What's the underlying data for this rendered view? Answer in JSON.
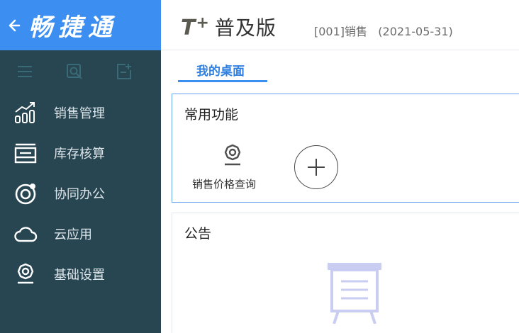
{
  "brand": {
    "title": "畅捷通",
    "back_icon": "arrow-left-icon"
  },
  "sidebar": {
    "toolbar": [
      {
        "icon": "menu-icon"
      },
      {
        "icon": "search-icon"
      },
      {
        "icon": "add-page-icon"
      }
    ],
    "items": [
      {
        "label": "销售管理",
        "icon": "sales-chart-icon"
      },
      {
        "label": "库存核算",
        "icon": "inventory-icon"
      },
      {
        "label": "协同办公",
        "icon": "collaboration-icon"
      },
      {
        "label": "云应用",
        "icon": "cloud-icon"
      },
      {
        "label": "基础设置",
        "icon": "settings-icon"
      }
    ]
  },
  "header": {
    "logo_main": "T",
    "logo_plus": "+",
    "edition": "普及版",
    "company_info": "[001]销售   (2021-05-31)"
  },
  "tabs": [
    {
      "label": "我的桌面",
      "active": true
    }
  ],
  "common_functions": {
    "title": "常用功能",
    "items": [
      {
        "label": "销售价格查询",
        "icon": "price-query-icon"
      }
    ],
    "add_icon": "plus-circle-icon"
  },
  "notice": {
    "title": "公告",
    "empty_icon": "empty-notice-icon"
  },
  "colors": {
    "sidebar_bg": "#284552",
    "brand_bg": "#3c8ff1",
    "accent": "#2f7fe0"
  }
}
